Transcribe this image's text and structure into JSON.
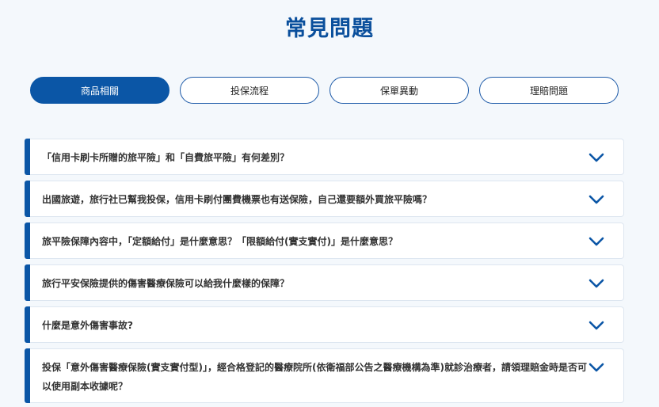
{
  "page": {
    "title": "常見問題"
  },
  "tabs": [
    {
      "label": "商品相關",
      "active": true
    },
    {
      "label": "投保流程",
      "active": false
    },
    {
      "label": "保單異動",
      "active": false
    },
    {
      "label": "理賠問題",
      "active": false
    }
  ],
  "faqs": [
    {
      "question": "「信用卡刷卡所贈的旅平險」和「自費旅平險」有何差別？"
    },
    {
      "question": "出國旅遊，旅行社已幫我投保，信用卡刷付團費機票也有送保險，自己還要額外買旅平險嗎？"
    },
    {
      "question": "旅平險保障內容中，「定額給付」是什麼意思？「限額給付(實支實付)」是什麼意思？"
    },
    {
      "question": "旅行平安保險提供的傷害醫療保險可以給我什麼樣的保障？"
    },
    {
      "question": "什麼是意外傷害事故?"
    },
    {
      "question": "投保「意外傷害醫療保險(實支實付型)」，經合格登記的醫療院所(依衛福部公告之醫療機構為準)就診治療者，請領理賠金時是否可以使用副本收據呢？"
    }
  ],
  "theme": {
    "accent": "#0b56a6",
    "title_color": "#0a4f9c",
    "background": "#f4f8fc"
  },
  "icons": {
    "expand": "chevron-down-icon"
  }
}
